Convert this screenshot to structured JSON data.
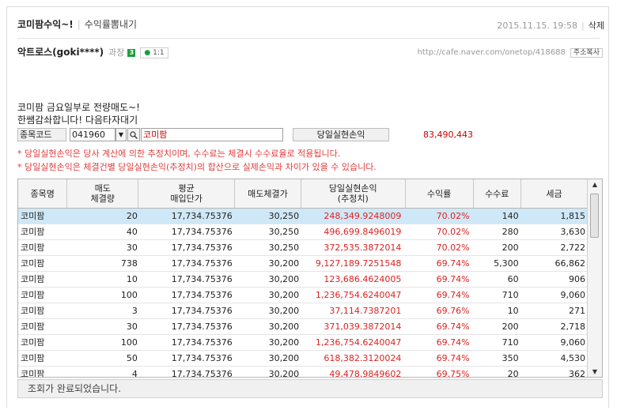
{
  "header": {
    "post_title": "코미팜수익~!",
    "board_name": "수익률뽐내기",
    "datetime": "2015.11.15. 19:58",
    "delete_label": "삭제"
  },
  "author": {
    "nickname": "악트로스(goki****)",
    "rank": "과장",
    "grade_badge": "3",
    "chat_label": "1:1"
  },
  "post_url": "http://cafe.naver.com/onetop/418688",
  "copy_address_label": "주소복사",
  "body_lines": [
    "코미팜 금요일부로 전량매도~!",
    "한쌤감솨합니다! 다음타자대기"
  ],
  "stock_panel": {
    "code_label": "종목코드",
    "code_value": "041960",
    "stock_name": "코미팜",
    "profit_label": "당일실현손익",
    "profit_value": "83,490,443"
  },
  "notices": [
    "* 당일실현손익은 당사 계산에 의한 추정치이며, 수수료는 체결시 수수료율로 적용됩니다.",
    "* 당일실현손익은 체결건별 당일실현손익(추정치)의 합산으로 실제손익과 차이가 있을 수 있습니다."
  ],
  "table": {
    "headers": [
      "종목명",
      "매도\n체결량",
      "평균\n매입단가",
      "매도체결가",
      "당일실현손익\n(추정치)",
      "수익률",
      "수수료",
      "세금"
    ],
    "rows": [
      [
        "코미팜",
        "20",
        "17,734.75376",
        "30,250",
        "248,349.9248009",
        "70.02%",
        "140",
        "1,815"
      ],
      [
        "코미팜",
        "40",
        "17,734.75376",
        "30,250",
        "496,699.8496019",
        "70.02%",
        "280",
        "3,630"
      ],
      [
        "코미팜",
        "30",
        "17,734.75376",
        "30,250",
        "372,535.3872014",
        "70.02%",
        "200",
        "2,722"
      ],
      [
        "코미팜",
        "738",
        "17,734.75376",
        "30,200",
        "9,127,189.7251548",
        "69.74%",
        "5,300",
        "66,862"
      ],
      [
        "코미팜",
        "10",
        "17,734.75376",
        "30,200",
        "123,686.4624005",
        "69.74%",
        "60",
        "906"
      ],
      [
        "코미팜",
        "100",
        "17,734.75376",
        "30,200",
        "1,236,754.6240047",
        "69.74%",
        "710",
        "9,060"
      ],
      [
        "코미팜",
        "3",
        "17,734.75376",
        "30,200",
        "37,114.7387201",
        "69.76%",
        "10",
        "271"
      ],
      [
        "코미팜",
        "30",
        "17,734.75376",
        "30,200",
        "371,039.3872014",
        "69.74%",
        "200",
        "2,718"
      ],
      [
        "코미팜",
        "100",
        "17,734.75376",
        "30,200",
        "1,236,754.6240047",
        "69.74%",
        "710",
        "9,060"
      ],
      [
        "코미팜",
        "50",
        "17,734.75376",
        "30,200",
        "618,382.3120024",
        "69.74%",
        "350",
        "4,530"
      ],
      [
        "코미팜",
        "4",
        "17,734.75376",
        "30,200",
        "49,478.9849602",
        "69.75%",
        "20",
        "362"
      ]
    ],
    "selected_row": 0
  },
  "status_text": "조회가 완료되었습니다.",
  "colors": {
    "accent_red": "#d22222",
    "selected_row": "#cfe8f7",
    "badge_green": "#1e9e3c"
  },
  "icons": {
    "dropdown": "chevron-down-icon",
    "search": "search-icon",
    "scroll_up": "arrow-up-icon",
    "scroll_down": "arrow-down-icon"
  }
}
